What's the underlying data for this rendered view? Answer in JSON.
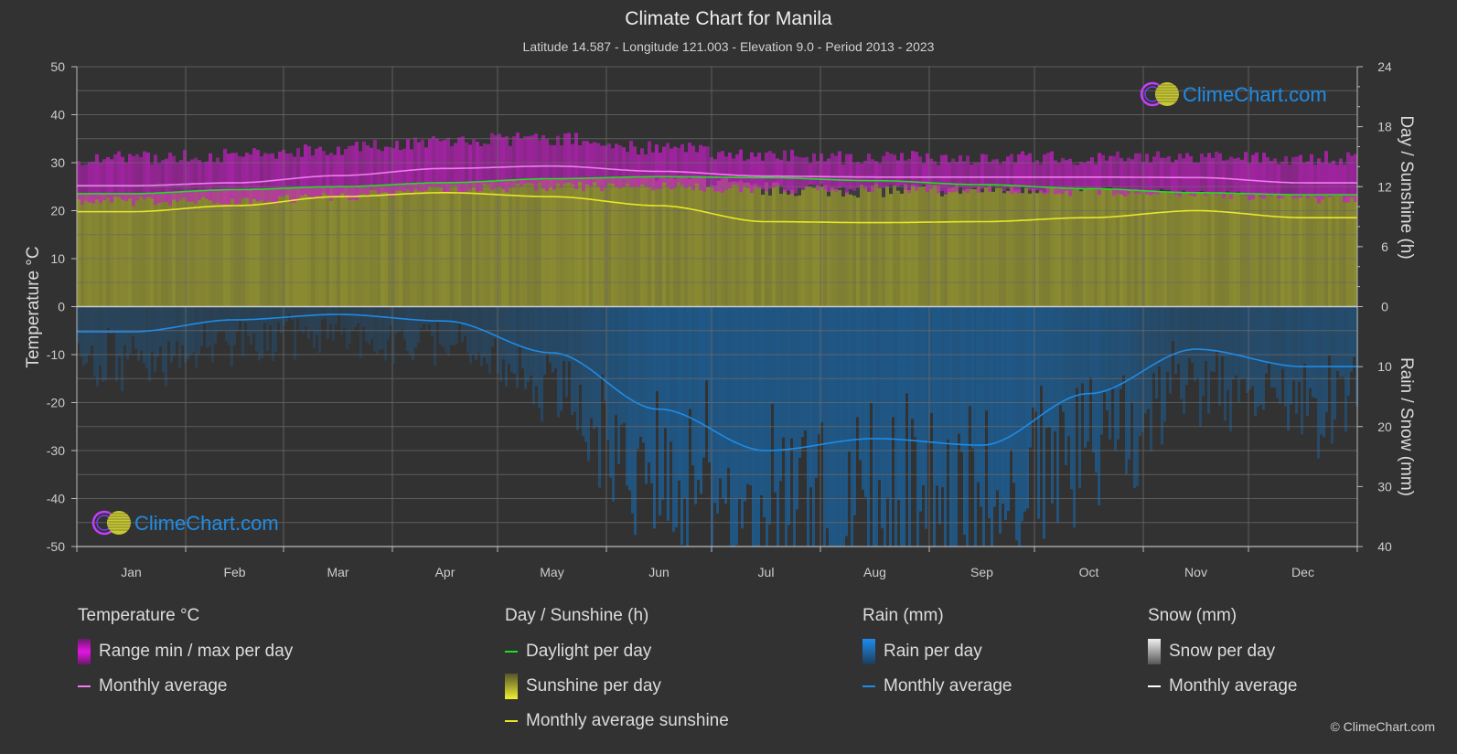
{
  "header": {
    "title": "Climate Chart for Manila",
    "subtitle": "Latitude 14.587 - Longitude 121.003 - Elevation 9.0 - Period 2013 - 2023"
  },
  "watermark": "ClimeChart.com",
  "copyright": "© ClimeChart.com",
  "colors": {
    "background": "#323232",
    "temp_range": "#c81ec8",
    "temp_avg": "#f07cf0",
    "daylight": "#22dd22",
    "sunshine_fill": "#8c8c32",
    "sunshine_avg": "#e8e828",
    "rain_fill": "#1e5a8c",
    "rain_avg": "#1e8ce6",
    "snow_avg": "#ffffff",
    "watermark_text": "#1e8ce6",
    "grid": "#5a5a5a"
  },
  "legend": {
    "temperature": {
      "title": "Temperature °C",
      "items": [
        {
          "label": "Range min / max per day",
          "kind": "box"
        },
        {
          "label": "Monthly average",
          "kind": "line"
        }
      ]
    },
    "sunshine": {
      "title": "Day / Sunshine (h)",
      "items": [
        {
          "label": "Daylight per day",
          "kind": "line"
        },
        {
          "label": "Sunshine per day",
          "kind": "box"
        },
        {
          "label": "Monthly average sunshine",
          "kind": "line"
        }
      ]
    },
    "rain": {
      "title": "Rain (mm)",
      "items": [
        {
          "label": "Rain per day",
          "kind": "box"
        },
        {
          "label": "Monthly average",
          "kind": "line"
        }
      ]
    },
    "snow": {
      "title": "Snow (mm)",
      "items": [
        {
          "label": "Snow per day",
          "kind": "box"
        },
        {
          "label": "Monthly average",
          "kind": "line"
        }
      ]
    }
  },
  "chart_data": {
    "type": "line",
    "title": "Climate Chart for Manila",
    "categories": [
      "Jan",
      "Feb",
      "Mar",
      "Apr",
      "May",
      "Jun",
      "Jul",
      "Aug",
      "Sep",
      "Oct",
      "Nov",
      "Dec"
    ],
    "left_axis": {
      "label": "Temperature °C",
      "range": [
        -50,
        50
      ],
      "ticks": [
        50,
        40,
        30,
        20,
        10,
        0,
        -10,
        -20,
        -30,
        -40,
        -50
      ]
    },
    "right_axis_top": {
      "label": "Day / Sunshine (h)",
      "range": [
        0,
        24
      ],
      "ticks": [
        24,
        18,
        12,
        6,
        0
      ]
    },
    "right_axis_bottom": {
      "label": "Rain / Snow (mm)",
      "range": [
        0,
        40
      ],
      "ticks": [
        0,
        10,
        20,
        30,
        40
      ]
    },
    "grid": true,
    "series": [
      {
        "name": "Temperature monthly average",
        "axis": "temperature",
        "unit": "°C",
        "values": [
          25.2,
          25.8,
          27.3,
          28.8,
          29.3,
          28.2,
          27.2,
          27.0,
          27.0,
          27.0,
          26.9,
          25.8
        ]
      },
      {
        "name": "Temperature daily max (approx. band top)",
        "axis": "temperature",
        "unit": "°C",
        "values": [
          31.0,
          31.5,
          33.0,
          34.5,
          35.0,
          33.0,
          31.5,
          31.0,
          31.0,
          31.0,
          31.0,
          31.0
        ]
      },
      {
        "name": "Temperature daily min (approx. band bottom)",
        "axis": "temperature",
        "unit": "°C",
        "values": [
          22.0,
          22.0,
          23.0,
          24.5,
          25.0,
          25.0,
          24.5,
          24.5,
          24.5,
          24.0,
          23.5,
          22.5
        ]
      },
      {
        "name": "Daylight per day",
        "axis": "sunshine",
        "unit": "h",
        "values": [
          11.3,
          11.7,
          12.0,
          12.4,
          12.8,
          13.0,
          12.9,
          12.6,
          12.2,
          11.8,
          11.4,
          11.2
        ]
      },
      {
        "name": "Monthly average sunshine",
        "axis": "sunshine",
        "unit": "h",
        "values": [
          9.5,
          10.1,
          11.0,
          11.4,
          11.0,
          10.1,
          8.5,
          8.4,
          8.5,
          8.9,
          9.6,
          8.9
        ]
      },
      {
        "name": "Rain monthly average",
        "axis": "rain",
        "unit": "mm",
        "values": [
          4.2,
          2.2,
          1.3,
          2.4,
          7.7,
          17.1,
          24.0,
          22.0,
          23.1,
          14.5,
          7.1,
          10.0
        ]
      },
      {
        "name": "Snow monthly average",
        "axis": "rain",
        "unit": "mm",
        "values": [
          0,
          0,
          0,
          0,
          0,
          0,
          0,
          0,
          0,
          0,
          0,
          0
        ]
      }
    ]
  }
}
